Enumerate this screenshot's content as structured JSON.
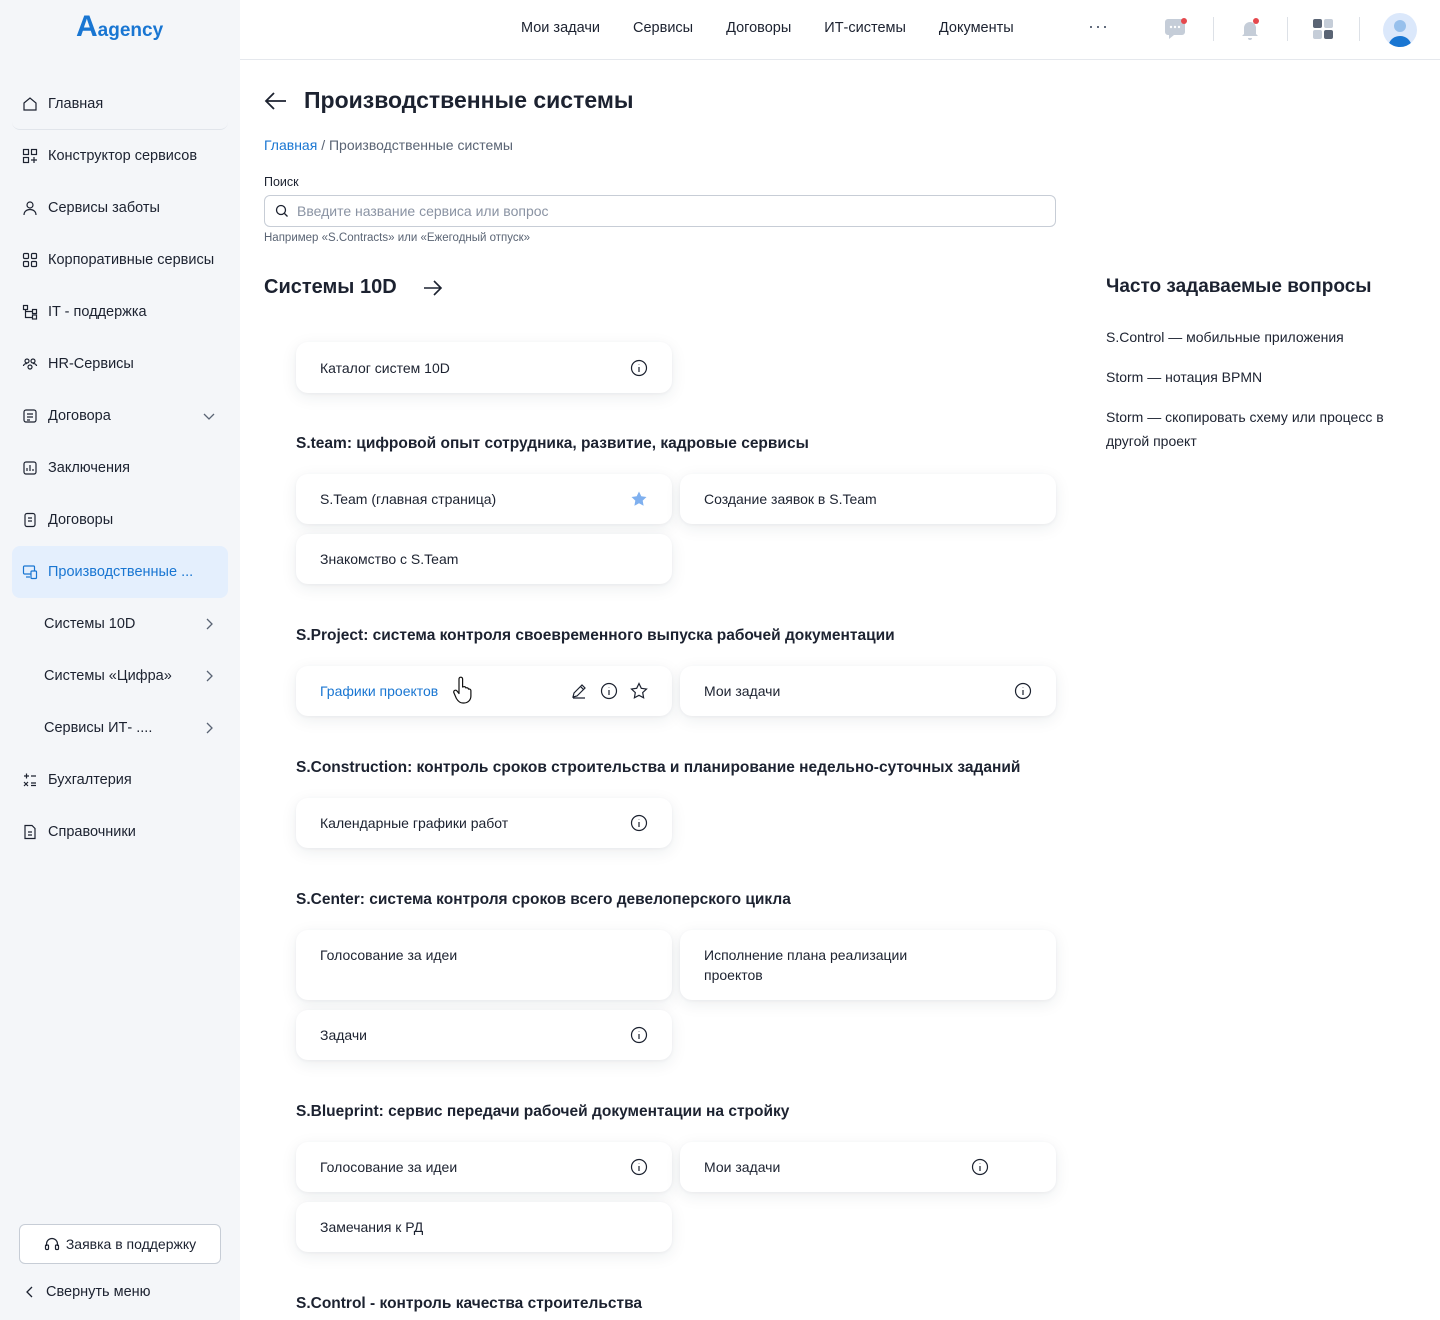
{
  "app": {
    "logo_mark": "A",
    "logo_text": "agency"
  },
  "sidebar": {
    "items": [
      {
        "label": "Главная"
      },
      {
        "label": "Конструктор сервисов"
      },
      {
        "label": "Сервисы заботы"
      },
      {
        "label": "Корпоративные сервисы"
      },
      {
        "label": "IT - поддержка"
      },
      {
        "label": "HR-Сервисы"
      },
      {
        "label": "Договора"
      },
      {
        "label": "Заключения"
      },
      {
        "label": "Договоры"
      },
      {
        "label": "Производственные ..."
      },
      {
        "label": "Системы 10D"
      },
      {
        "label": "Системы «Цифра»"
      },
      {
        "label": "Сервисы ИТ- ...."
      },
      {
        "label": "Бухгалтерия"
      },
      {
        "label": "Справочники"
      }
    ],
    "support_button": "Заявка в поддержку",
    "collapse_label": "Свернуть меню"
  },
  "topbar": {
    "links": [
      "Мои задачи",
      "Сервисы",
      "Договоры",
      "ИТ-системы",
      "Документы"
    ],
    "more": "···"
  },
  "page": {
    "title": "Производственные системы",
    "breadcrumb": {
      "home": "Главная",
      "separator": "/",
      "current": "Производственные системы"
    },
    "search": {
      "label": "Поиск",
      "placeholder": "Введите название сервиса или вопрос",
      "hint": "Например «S.Contracts» или «Ежегодный отпуск»"
    },
    "section_title": "Системы 10D"
  },
  "groups": [
    {
      "title": "",
      "cards": [
        {
          "label": "Каталог систем 10D"
        }
      ]
    },
    {
      "title": "S.team: цифровой опыт сотрудника, развитие, кадровые сервисы",
      "cards": [
        {
          "label": "S.Team (главная страница)"
        },
        {
          "label": "Создание заявок в S.Team"
        },
        {
          "label": "Знакомство с S.Team"
        }
      ]
    },
    {
      "title": "S.Project: система контроля своевременного выпуска рабочей документации",
      "cards": [
        {
          "label": "Графики проектов"
        },
        {
          "label": "Мои задачи"
        }
      ]
    },
    {
      "title": "S.Construction: контроль сроков строительства и планирование недельно-суточных заданий",
      "cards": [
        {
          "label": "Календарные графики работ"
        }
      ]
    },
    {
      "title": "S.Center: система контроля сроков всего девелоперского цикла",
      "cards": [
        {
          "label": "Голосование за идеи"
        },
        {
          "label": "Исполнение плана реализации проектов"
        },
        {
          "label": "Задачи"
        }
      ]
    },
    {
      "title": "S.Blueprint: сервис передачи рабочей документации на стройку",
      "cards": [
        {
          "label": "Голосование за идеи"
        },
        {
          "label": "Мои задачи"
        },
        {
          "label": "Замечания к РД"
        }
      ]
    },
    {
      "title": "S.Control - контроль качества строительства",
      "cards": []
    }
  ],
  "faq": {
    "title": "Часто задаваемые вопросы",
    "items": [
      "S.Control — мобильные приложения",
      "Storm — нотация BPMN",
      "Storm — скопировать схему или процесс в другой проект"
    ]
  },
  "colors": {
    "accent": "#1976d2",
    "active_bg": "#e4effd",
    "sidebar_bg": "#f4f6f9",
    "notification": "#e5484d"
  }
}
